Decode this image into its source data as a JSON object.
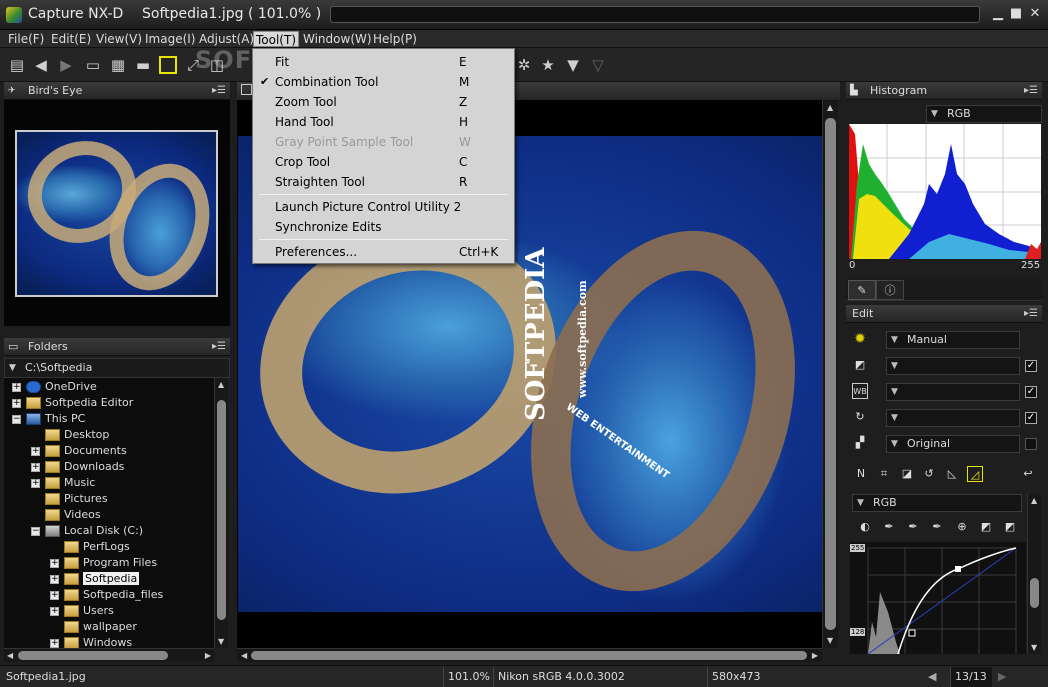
{
  "window": {
    "app_name": "Capture NX-D",
    "document_title": "Softpedia1.jpg ( 101.0% )"
  },
  "menu": [
    {
      "label": "File(F)"
    },
    {
      "label": "Edit(E)"
    },
    {
      "label": "View(V)"
    },
    {
      "label": "Image(I)"
    },
    {
      "label": "Adjust(A)"
    },
    {
      "label": "Tool(T)"
    },
    {
      "label": "Window(W)"
    },
    {
      "label": "Help(P)"
    }
  ],
  "watermark": "SOFTPEDIA",
  "tool_menu": [
    {
      "label": "Fit",
      "shortcut": "E",
      "checked": false,
      "disabled": false
    },
    {
      "label": "Combination Tool",
      "shortcut": "M",
      "checked": true,
      "disabled": false
    },
    {
      "label": "Zoom Tool",
      "shortcut": "Z",
      "checked": false,
      "disabled": false
    },
    {
      "label": "Hand Tool",
      "shortcut": "H",
      "checked": false,
      "disabled": false
    },
    {
      "label": "Gray Point Sample Tool",
      "shortcut": "W",
      "checked": false,
      "disabled": true
    },
    {
      "label": "Crop Tool",
      "shortcut": "C",
      "checked": false,
      "disabled": false
    },
    {
      "label": "Straighten Tool",
      "shortcut": "R",
      "checked": false,
      "disabled": false
    },
    {
      "label": "Launch Picture Control Utility 2",
      "shortcut": "",
      "checked": false,
      "disabled": false
    },
    {
      "label": "Synchronize Edits",
      "shortcut": "",
      "checked": false,
      "disabled": false
    },
    {
      "label": "Preferences...",
      "shortcut": "Ctrl+K",
      "checked": false,
      "disabled": false
    }
  ],
  "birds_eye": {
    "title": "Bird's Eye"
  },
  "folders": {
    "title": "Folders",
    "path": "C:\\Softpedia",
    "items": [
      {
        "label": "OneDrive",
        "icon": "cloud"
      },
      {
        "label": "Softpedia Editor",
        "icon": "user-folder"
      },
      {
        "label": "This PC",
        "icon": "pc"
      },
      {
        "label": "Desktop",
        "icon": "folder"
      },
      {
        "label": "Documents",
        "icon": "folder"
      },
      {
        "label": "Downloads",
        "icon": "folder"
      },
      {
        "label": "Music",
        "icon": "folder"
      },
      {
        "label": "Pictures",
        "icon": "folder"
      },
      {
        "label": "Videos",
        "icon": "folder"
      },
      {
        "label": "Local Disk (C:)",
        "icon": "drive"
      },
      {
        "label": "PerfLogs",
        "icon": "folder"
      },
      {
        "label": "Program Files",
        "icon": "folder"
      },
      {
        "label": "Softpedia",
        "icon": "folder",
        "selected": true
      },
      {
        "label": "Softpedia_files",
        "icon": "folder"
      },
      {
        "label": "Users",
        "icon": "folder"
      },
      {
        "label": "wallpaper",
        "icon": "folder"
      },
      {
        "label": "Windows",
        "icon": "folder"
      }
    ]
  },
  "image_text": {
    "big": "SOFTPEDIA",
    "small": "www.softpedia.com",
    "curve": "WEB ENTERTAINMENT"
  },
  "histogram": {
    "title": "Histogram",
    "channel": "RGB",
    "min_label": "0",
    "max_label": "255"
  },
  "edit": {
    "title": "Edit",
    "picture_control": "Manual",
    "color_space": "Original",
    "curve_channel": "RGB",
    "curve_ticks": {
      "top": "255",
      "mid": "128"
    }
  },
  "status": {
    "filename": "Softpedia1.jpg",
    "zoom": "101.0%",
    "profile": "Nikon sRGB 4.0.0.3002",
    "dimensions": "580x473",
    "page": "13/13"
  },
  "colors": {
    "accent_yellow": "#e6e600",
    "menu_bg": "#d4d4d4",
    "panel_bg": "#1e1e1e"
  }
}
